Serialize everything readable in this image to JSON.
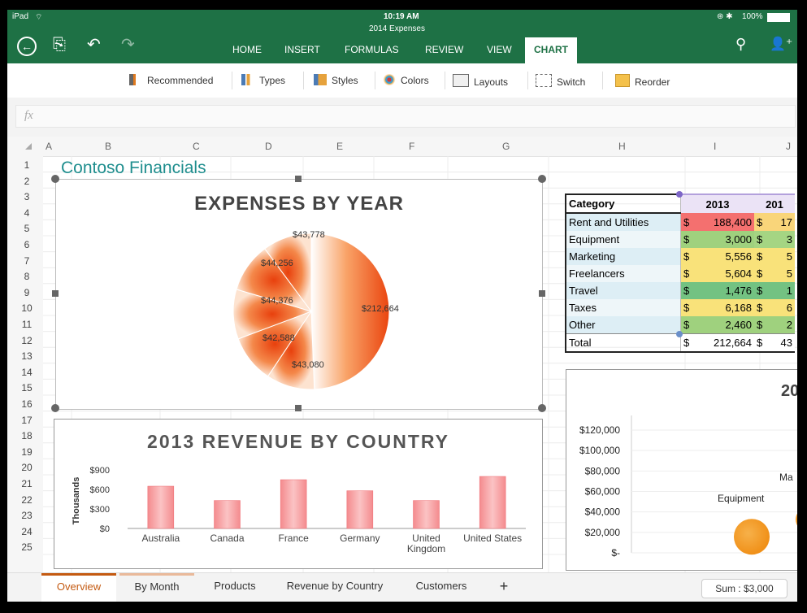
{
  "status": {
    "device": "iPad",
    "time": "10:19 AM",
    "doc": "2014 Expenses",
    "battery": "100%"
  },
  "ribbon": {
    "tabs": [
      "HOME",
      "INSERT",
      "FORMULAS",
      "REVIEW",
      "VIEW",
      "CHART"
    ],
    "active": "CHART"
  },
  "toolbar": {
    "items": [
      "Recommended",
      "Types",
      "Styles",
      "Colors",
      "Layouts",
      "Switch",
      "Reorder"
    ]
  },
  "formula": {
    "fx": "fx"
  },
  "columns": [
    "A",
    "B",
    "C",
    "D",
    "E",
    "F",
    "G",
    "H",
    "I",
    "J"
  ],
  "rows": [
    "1",
    "2",
    "3",
    "4",
    "5",
    "6",
    "7",
    "8",
    "9",
    "10",
    "11",
    "12",
    "13",
    "14",
    "15",
    "16",
    "17",
    "18",
    "19",
    "20",
    "21",
    "22",
    "23",
    "24",
    "25"
  ],
  "sheet_title": "Contoso Financials",
  "chart_data": [
    {
      "type": "pie",
      "title": "EXPENSES BY YEAR",
      "categories": [
        "$212,664",
        "$43,080",
        "$42,588",
        "$44,376",
        "$44,256",
        "$43,778"
      ],
      "values": [
        212664,
        43080,
        42588,
        44376,
        44256,
        43778
      ],
      "labels": [
        "$212,664",
        "$43,080",
        "$42,588",
        "$44,376",
        "$44,256",
        "$43,778"
      ]
    },
    {
      "type": "bar",
      "title": "2013 REVENUE BY COUNTRY",
      "categories": [
        "Australia",
        "Canada",
        "France",
        "Germany",
        "United Kingdom",
        "United States"
      ],
      "category_labels": [
        [
          "Australia"
        ],
        [
          "Canada"
        ],
        [
          "France"
        ],
        [
          "Germany"
        ],
        [
          "United",
          "Kingdom"
        ],
        [
          "United States"
        ]
      ],
      "values": [
        650,
        430,
        750,
        580,
        430,
        800
      ],
      "ylabel": "Thousands",
      "yticks": [
        "$900",
        "$600",
        "$300",
        "$0"
      ],
      "ylim": [
        0,
        900
      ]
    },
    {
      "type": "scatter",
      "title": "20",
      "yticks": [
        "$120,000",
        "$100,000",
        "$80,000",
        "$60,000",
        "$40,000",
        "$20,000",
        "$-"
      ],
      "points": [
        {
          "label": "Equipment",
          "y": 3000
        },
        {
          "label": "Ma",
          "y": 5556
        }
      ]
    }
  ],
  "table": {
    "header": [
      "Category",
      "2013",
      "201"
    ],
    "rows": [
      {
        "cat": "Rent and Utilities",
        "v2013": "188,400",
        "v2014": "17",
        "color": "#f4706f",
        "color2": "#f9d57a"
      },
      {
        "cat": "Equipment",
        "v2013": "3,000",
        "v2014": "3",
        "color": "#9fd17e",
        "color2": "#a5d583"
      },
      {
        "cat": "Marketing",
        "v2013": "5,556",
        "v2014": "5",
        "color": "#f9e27a",
        "color2": "#f9e27a"
      },
      {
        "cat": "Freelancers",
        "v2013": "5,604",
        "v2014": "5",
        "color": "#f9e27a",
        "color2": "#f9e27a"
      },
      {
        "cat": "Travel",
        "v2013": "1,476",
        "v2014": "1",
        "color": "#73c282",
        "color2": "#73c282"
      },
      {
        "cat": "Taxes",
        "v2013": "6,168",
        "v2014": "6",
        "color": "#f9e27a",
        "color2": "#f9e27a"
      },
      {
        "cat": "Other",
        "v2013": "2,460",
        "v2014": "2",
        "color": "#9fd17e",
        "color2": "#9fd17e"
      },
      {
        "cat": "Total",
        "v2013": "212,664",
        "v2014": "43",
        "color": "#ffffff",
        "color2": "#ffffff"
      }
    ],
    "currency": "$"
  },
  "sheet_tabs": [
    "Overview",
    "By Month",
    "Products",
    "Revenue by Country",
    "Customers"
  ],
  "add_tab": "+",
  "sum": "Sum : $3,000",
  "colors": {
    "accent": "#1e7145",
    "tab_active": "#c45a11",
    "title": "#1f8e8e"
  }
}
